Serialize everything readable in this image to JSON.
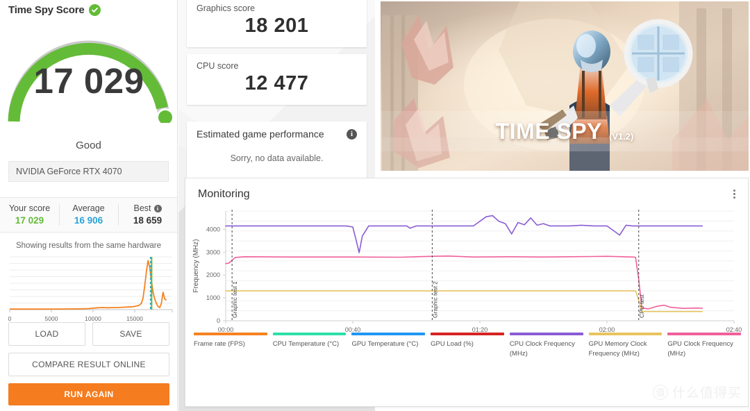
{
  "left": {
    "title": "Time Spy Score",
    "verified_icon": "check-circle-icon",
    "score": "17 029",
    "rating": "Good",
    "gpu": "NVIDIA GeForce RTX 4070",
    "stats": [
      {
        "label": "Your score",
        "value": "17 029",
        "color": "#63bb37"
      },
      {
        "label": "Average",
        "value": "16 906",
        "color": "#2aa3d8"
      },
      {
        "label": "Best",
        "value": "18 659",
        "color": "#333333",
        "info_icon": "info-icon"
      }
    ],
    "distribution_note": "Showing results from the same hardware",
    "buttons": {
      "load": "LOAD",
      "save": "SAVE",
      "compare": "COMPARE RESULT ONLINE",
      "run_again": "RUN AGAIN"
    }
  },
  "middle": {
    "graphics": {
      "label": "Graphics score",
      "value": "18 201"
    },
    "cpu": {
      "label": "CPU score",
      "value": "12 477"
    },
    "estimated": {
      "title": "Estimated game performance",
      "info_icon": "info-icon",
      "body": "Sorry, no data available."
    }
  },
  "hero": {
    "title": "TIME SPY",
    "version": "(V1.2)"
  },
  "monitoring": {
    "title": "Monitoring",
    "menu_icon": "kebab-menu-icon"
  },
  "watermark": {
    "logo": "值",
    "text": "什么值得买"
  },
  "chart_data": [
    {
      "type": "line",
      "name": "score-distribution",
      "title": "Showing results from the same hardware",
      "xlabel": "",
      "ylabel": "",
      "xlim": [
        0,
        19500
      ],
      "ylim": [
        0,
        1
      ],
      "xticks": [
        "0",
        "5000",
        "10000",
        "15000"
      ],
      "xtick_values": [
        0,
        5000,
        10000,
        15000
      ],
      "grid": true,
      "legend": "none",
      "series": [
        {
          "name": "Result distribution",
          "color": "#f58220",
          "x": [
            0,
            2000,
            4000,
            6000,
            8000,
            9500,
            10500,
            11200,
            11800,
            12400,
            13000,
            13600,
            14200,
            14800,
            15200,
            15500,
            15800,
            16000,
            16200,
            16400,
            16600,
            16800,
            17000,
            17200,
            17400,
            17600,
            17800,
            18000,
            18200,
            18400,
            18600,
            18800
          ],
          "y": [
            0.01,
            0.01,
            0.01,
            0.012,
            0.014,
            0.02,
            0.035,
            0.04,
            0.035,
            0.04,
            0.04,
            0.045,
            0.05,
            0.055,
            0.07,
            0.08,
            0.12,
            0.22,
            0.45,
            0.72,
            0.93,
            0.8,
            0.55,
            0.33,
            0.2,
            0.12,
            0.06,
            0.04,
            0.12,
            0.33,
            0.2,
            0.18
          ]
        }
      ],
      "markers": [
        {
          "name": "average-marker",
          "x": 16906,
          "color": "#2aa3d8",
          "style": "dashed"
        },
        {
          "name": "your-score-marker",
          "x": 17029,
          "color": "#63bb37",
          "style": "solid"
        }
      ]
    },
    {
      "type": "line",
      "name": "monitoring-chart",
      "title": "Monitoring",
      "xlabel": "",
      "ylabel": "Frequency (MHz)",
      "xlim": [
        0,
        160
      ],
      "ylim": [
        0,
        4800
      ],
      "yticks": [
        "0",
        "1000",
        "2000",
        "3000",
        "4000"
      ],
      "ytick_values": [
        0,
        1000,
        2000,
        3000,
        4000
      ],
      "xticks": [
        "00:00",
        "00:40",
        "01:20",
        "02:00",
        "02:40"
      ],
      "xtick_values": [
        0,
        40,
        80,
        120,
        160
      ],
      "grid": true,
      "legend": "bottom",
      "annotations": [
        {
          "label": "Graphic test 1",
          "x": 2,
          "style": "dashed-vertical"
        },
        {
          "label": "Graphic test 2",
          "x": 65,
          "style": "dashed-vertical"
        },
        {
          "label": "CPU test",
          "x": 130,
          "style": "dashed-vertical"
        }
      ],
      "series": [
        {
          "name": "Frame rate (FPS)",
          "color": "#f58220",
          "x": [],
          "y": []
        },
        {
          "name": "CPU Temperature (°C)",
          "color": "#2ee0a8",
          "x": [],
          "y": []
        },
        {
          "name": "GPU Temperature (°C)",
          "color": "#2196f3",
          "x": [],
          "y": []
        },
        {
          "name": "GPU Load (%)",
          "color": "#d62323",
          "x": [],
          "y": []
        },
        {
          "name": "CPU Clock Frequency (MHz)",
          "color": "#8a5cd4",
          "x": [
            0,
            2,
            10,
            20,
            30,
            38,
            40,
            41,
            42,
            43,
            45,
            50,
            57,
            58,
            60,
            62,
            65,
            70,
            78,
            82,
            84,
            86,
            88,
            90,
            92,
            94,
            96,
            98,
            100,
            102,
            104,
            106,
            108,
            112,
            116,
            120,
            124,
            126,
            128,
            130,
            140,
            150
          ],
          "y": [
            4150,
            4150,
            4150,
            4150,
            4150,
            4150,
            4100,
            3550,
            2980,
            3700,
            4150,
            4150,
            4150,
            4050,
            4150,
            4150,
            4150,
            4150,
            4150,
            4550,
            4600,
            4350,
            4250,
            3800,
            4300,
            4200,
            4500,
            4180,
            4250,
            4150,
            4150,
            4150,
            4150,
            4180,
            4150,
            4150,
            3750,
            4180,
            4150,
            4150,
            4150,
            4150
          ]
        },
        {
          "name": "GPU Memory Clock Frequency (MHz)",
          "color": "#e8c45e",
          "x": [
            0,
            2,
            20,
            40,
            60,
            80,
            100,
            120,
            129,
            130,
            131,
            140,
            150
          ],
          "y": [
            1310,
            1310,
            1310,
            1310,
            1310,
            1310,
            1310,
            1310,
            1310,
            900,
            405,
            405,
            405
          ]
        },
        {
          "name": "GPU Clock Frequency (MHz)",
          "color": "#f0609a",
          "x": [
            0,
            1,
            3,
            6,
            20,
            40,
            55,
            60,
            65,
            70,
            78,
            90,
            100,
            108,
            115,
            120,
            125,
            128,
            129,
            130,
            131,
            133,
            136,
            138,
            140,
            144,
            148,
            150
          ],
          "y": [
            2500,
            2520,
            2770,
            2800,
            2790,
            2790,
            2780,
            2800,
            2820,
            2830,
            2790,
            2800,
            2790,
            2800,
            2810,
            2820,
            2800,
            2790,
            2780,
            1800,
            560,
            520,
            640,
            680,
            590,
            540,
            555,
            550
          ]
        }
      ]
    }
  ]
}
